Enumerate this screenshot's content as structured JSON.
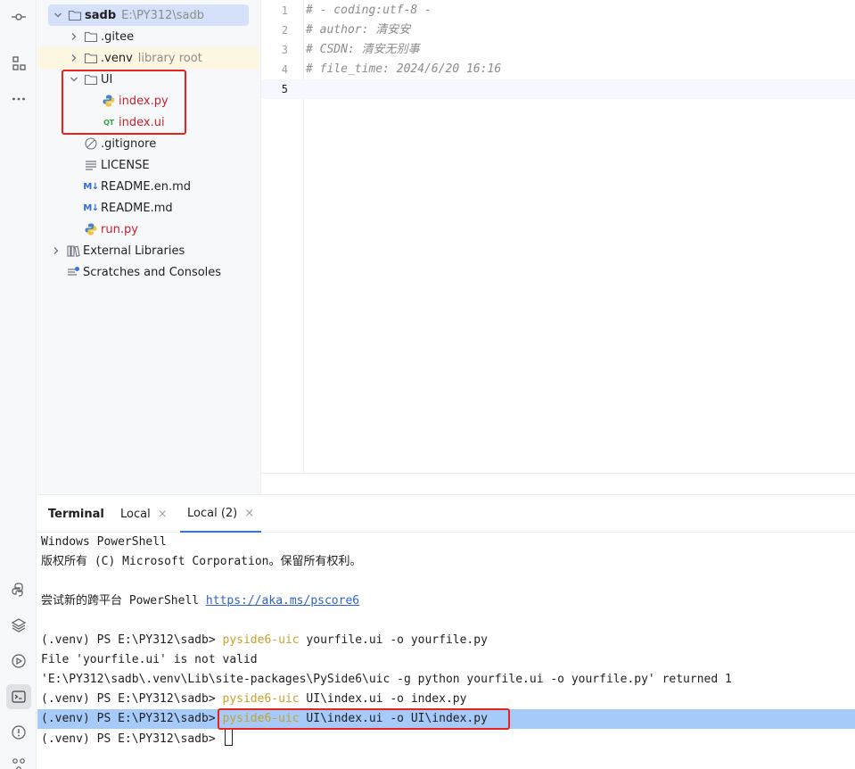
{
  "project_tree": {
    "root": {
      "name": "sadb",
      "path": "E:\\PY312\\sadb"
    },
    "items": [
      {
        "name": ".gitee"
      },
      {
        "name": ".venv",
        "hint": "library root"
      },
      {
        "name": "UI"
      },
      {
        "name": "index.py"
      },
      {
        "name": "index.ui"
      },
      {
        "name": ".gitignore"
      },
      {
        "name": "LICENSE"
      },
      {
        "name": "README.en.md"
      },
      {
        "name": "README.md"
      },
      {
        "name": "run.py"
      },
      {
        "name": "External Libraries"
      },
      {
        "name": "Scratches and Consoles"
      }
    ]
  },
  "editor": {
    "lines": [
      {
        "num": "1",
        "text": "# - coding:utf-8 -"
      },
      {
        "num": "2",
        "text": "# author: 清安安"
      },
      {
        "num": "3",
        "text": "# CSDN: 清安无别事"
      },
      {
        "num": "4",
        "text": "# file_time: 2024/6/20 16:16"
      },
      {
        "num": "5",
        "text": ""
      }
    ]
  },
  "terminal": {
    "tabs": [
      {
        "label": "Terminal"
      },
      {
        "label": "Local",
        "close": "×"
      },
      {
        "label": "Local (2)",
        "close": "×"
      }
    ],
    "lines": {
      "l1": "Windows PowerShell",
      "l2": "版权所有 (C) Microsoft Corporation。保留所有权利。",
      "l4_prefix": "尝试新的跨平台 PowerShell ",
      "l4_link": "https://aka.ms/pscore6",
      "prompt": "(.venv) PS E:\\PY312\\sadb> ",
      "cmd_name": "pyside6-uic",
      "l6_args": " yourfile.ui -o yourfile.py",
      "l7": "File 'yourfile.ui' is not valid",
      "l8": "'E:\\PY312\\sadb\\.venv\\Lib\\site-packages\\PySide6\\uic -g python yourfile.ui -o yourfile.py' returned 1",
      "l9_args": " UI\\index.ui -o index.py",
      "l10_args": " UI\\index.ui -o UI\\index.py"
    }
  },
  "colors": {
    "accent": "#3574f0",
    "highlight_box": "#e8231b",
    "command": "#c9a227",
    "selection": "#a6cbfb",
    "error_file": "#c7222d"
  }
}
